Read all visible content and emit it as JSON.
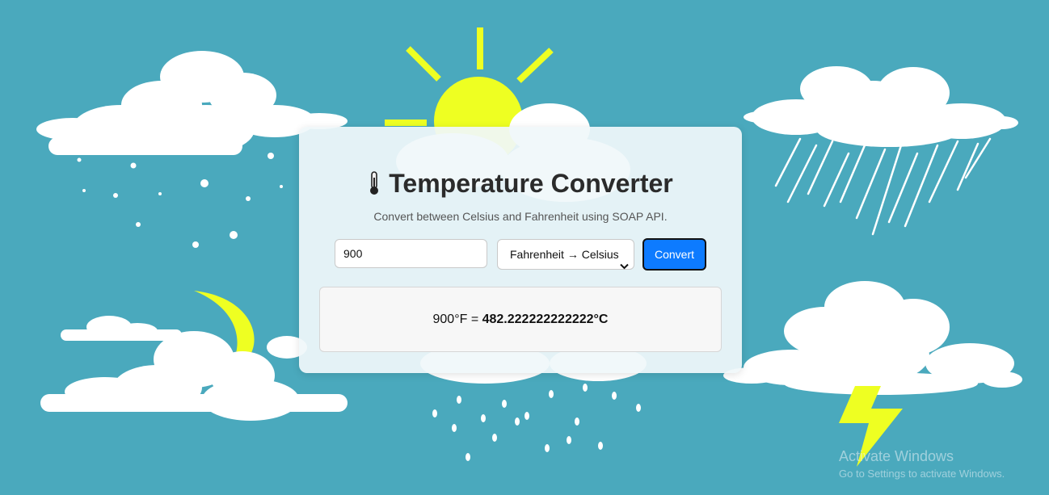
{
  "converter": {
    "title": "Temperature Converter",
    "subtitle": "Convert between Celsius and Fahrenheit using SOAP API.",
    "input_value": "900",
    "mode_selected": "Fahrenheit → Celsius",
    "convert_label": "Convert",
    "result_prefix": "900°F = ",
    "result_value": "482.222222222222°C"
  },
  "watermark": {
    "title": "Activate Windows",
    "subtitle": "Go to Settings to activate Windows."
  },
  "colors": {
    "background": "#4aa9bd",
    "sun": "#eeff22",
    "cloud": "#ffffff",
    "button": "#0d7bff"
  },
  "icons": [
    "thermometer-icon",
    "chevron-down-icon"
  ]
}
